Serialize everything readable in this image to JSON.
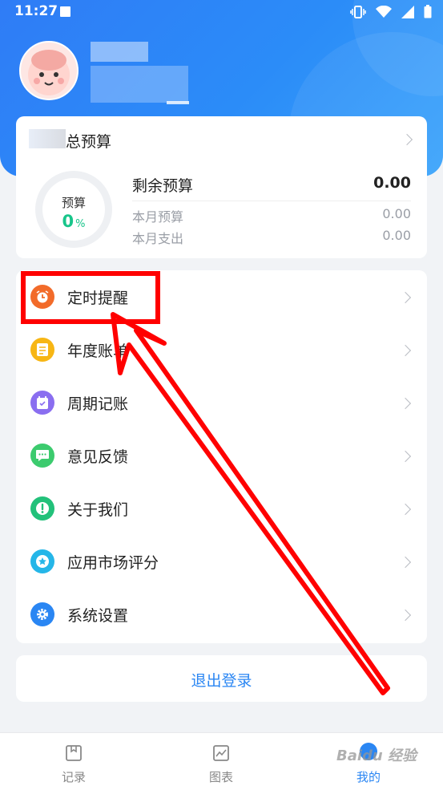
{
  "status_bar": {
    "time": "11:27"
  },
  "budget": {
    "title": "总预算",
    "ring_label": "预算",
    "percent_value": "0",
    "percent_sign": "%",
    "remaining_label": "剩余预算",
    "remaining_value": "0.00",
    "month_budget_label": "本月预算",
    "month_budget_value": "0.00",
    "month_expense_label": "本月支出",
    "month_expense_value": "0.00"
  },
  "menu": {
    "items": [
      {
        "label": "定时提醒",
        "icon": "alarm-clock-icon",
        "color": "#f26b2a"
      },
      {
        "label": "年度账单",
        "icon": "bill-icon",
        "color": "#f7b614"
      },
      {
        "label": "周期记账",
        "icon": "calendar-icon",
        "color": "#8a6ef0"
      },
      {
        "label": "意见反馈",
        "icon": "chat-bubble-icon",
        "color": "#3ccb6e"
      },
      {
        "label": "关于我们",
        "icon": "info-icon",
        "color": "#22c17a"
      },
      {
        "label": "应用市场评分",
        "icon": "star-icon",
        "color": "#25b6e8"
      },
      {
        "label": "系统设置",
        "icon": "gear-icon",
        "color": "#2a86f3"
      }
    ]
  },
  "logout_label": "退出登录",
  "tabs": [
    {
      "label": "记录",
      "icon": "record-book-icon"
    },
    {
      "label": "图表",
      "icon": "chart-icon"
    },
    {
      "label": "我的",
      "icon": "profile-icon",
      "active": true
    }
  ],
  "watermark": "Baidu 经验",
  "colors": {
    "header": "#2f86f6",
    "accent": "#2a86f3",
    "percent": "#18c58a",
    "annotation": "#ff0000"
  }
}
